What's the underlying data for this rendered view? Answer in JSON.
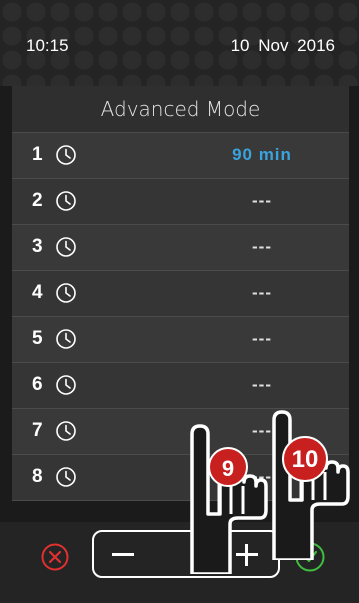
{
  "status": {
    "time": "10:15",
    "date": "10  Nov  2016"
  },
  "screen": {
    "title": "Advanced Mode"
  },
  "rows": [
    {
      "num": "1",
      "value": "90 min"
    },
    {
      "num": "2",
      "value": "---"
    },
    {
      "num": "3",
      "value": "---"
    },
    {
      "num": "4",
      "value": "---"
    },
    {
      "num": "5",
      "value": "---"
    },
    {
      "num": "6",
      "value": "---"
    },
    {
      "num": "7",
      "value": "---"
    },
    {
      "num": "8",
      "value": "---"
    }
  ],
  "callouts": {
    "step_a": "9",
    "step_b": "10"
  },
  "colors": {
    "accent": "#3aa3de",
    "cancel": "#e03030",
    "confirm": "#3fbf3f",
    "badge": "#c8201e"
  },
  "icons": {
    "row": "clock-icon",
    "cancel": "cancel-icon",
    "confirm": "confirm-icon",
    "pointer": "pointing-hand-icon"
  }
}
